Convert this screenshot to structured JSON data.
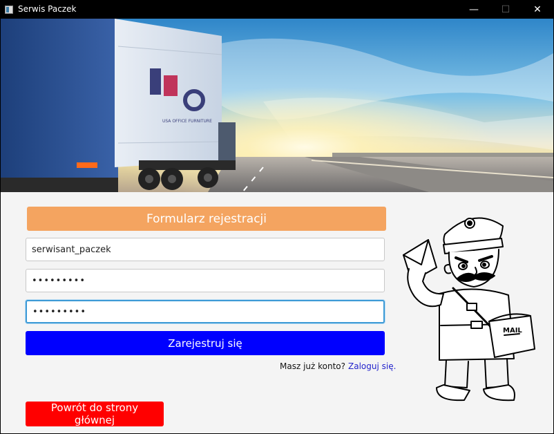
{
  "window": {
    "title": "Serwis Paczek",
    "minimize_glyph": "—",
    "maximize_glyph": "☐",
    "close_glyph": "✕"
  },
  "hero": {
    "image": "truck-on-highway-at-sunrise",
    "logo_text": "USA OFFICE FURNITURE"
  },
  "form": {
    "header": "Formularz rejestracji",
    "username_value": "serwisant_paczek",
    "password_value": "•••••••••",
    "confirm_password_value": "•••••••••",
    "register_label": "Zarejestruj się",
    "login_prompt": "Masz już konto?",
    "login_link": "Zaloguj się."
  },
  "footer": {
    "back_label": "Powrót do strony głównej"
  },
  "illustration": {
    "image": "postman-cartoon",
    "bag_text": "MAIL"
  },
  "colors": {
    "header_bg": "#f4a460",
    "register_bg": "#0000ff",
    "back_bg": "#ff0000",
    "link": "#2323cc",
    "focus_border": "#3d9ad6"
  }
}
